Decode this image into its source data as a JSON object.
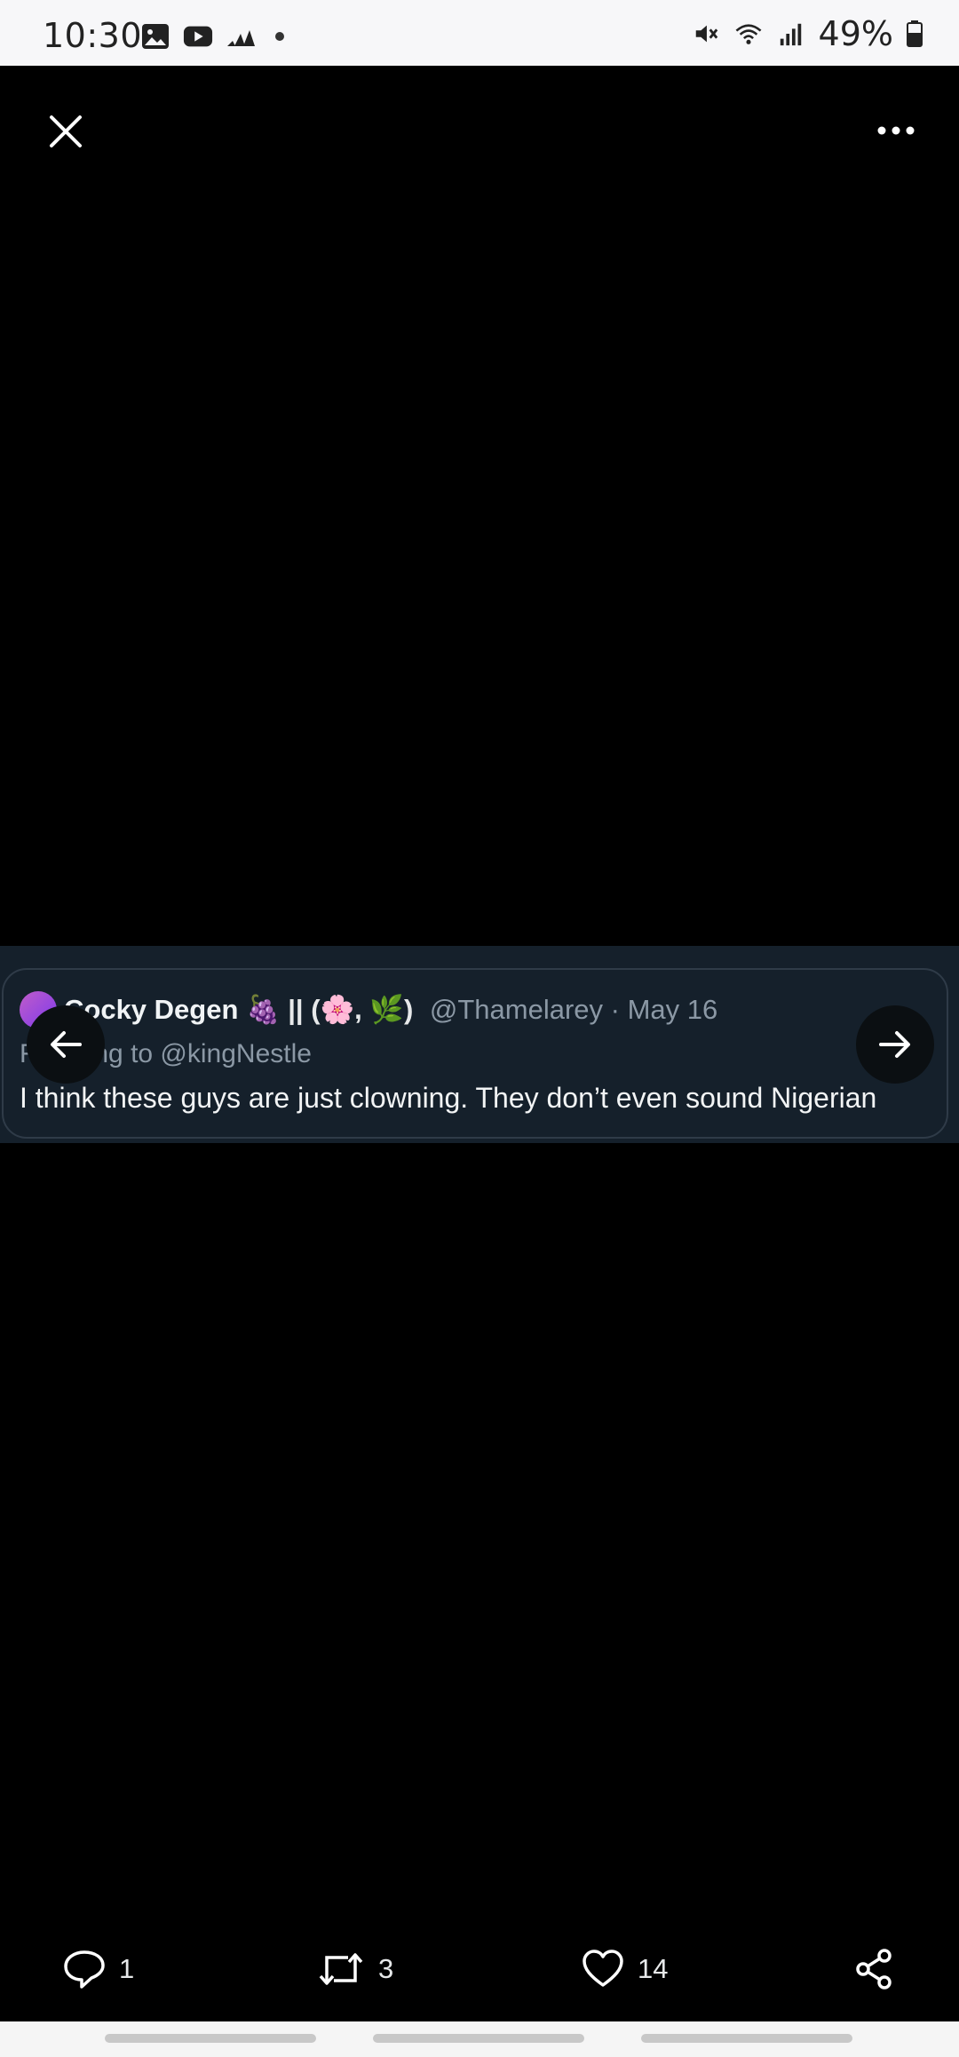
{
  "status_bar": {
    "time": "10:30",
    "battery": "49%",
    "icons_left": [
      "gallery-icon",
      "youtube-icon",
      "adidas-icon",
      "dot-icon"
    ],
    "icons_right": [
      "mute-icon",
      "wifi-icon",
      "signal-icon",
      "battery-icon"
    ]
  },
  "viewer": {
    "close_icon": "close-icon",
    "more_icon": "more-icon"
  },
  "tweet": {
    "display_name": "Cocky Degen",
    "name_suffix": "🍇 || (🌸, 🌿)",
    "handle_date": "@Thamelarey · May 16",
    "reply_to": "Replying to @kingNestle",
    "text": "I think these guys are just clowning. They don’t even sound Nigerian"
  },
  "actions": {
    "reply_count": "1",
    "retweet_count": "3",
    "like_count": "14"
  }
}
